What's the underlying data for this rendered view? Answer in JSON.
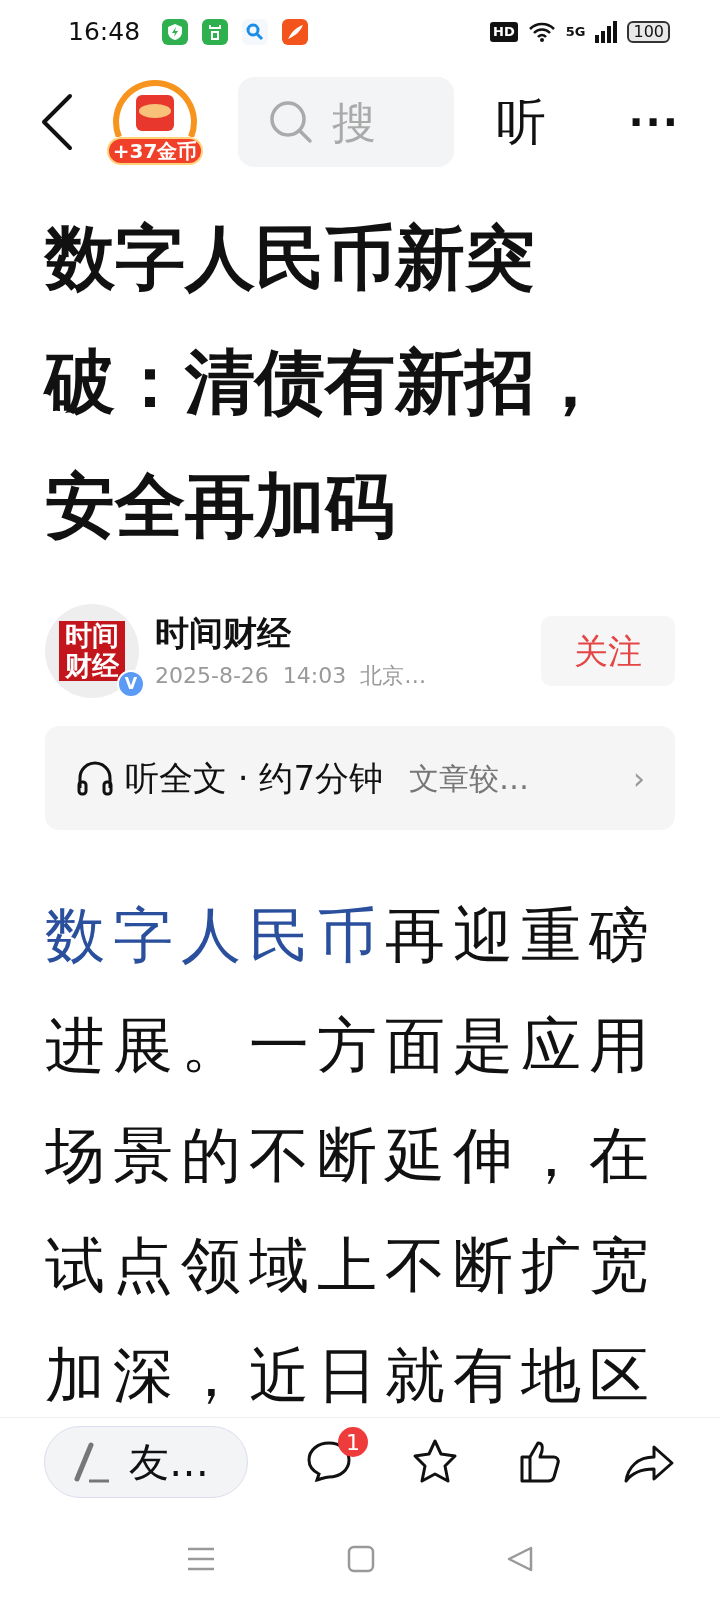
{
  "status_bar": {
    "time": "16:48",
    "hd": "HD",
    "network": "5G",
    "battery": "100"
  },
  "header": {
    "coin_badge": "+37金币",
    "search": {
      "placeholder": "搜"
    },
    "listen": "听",
    "more": "···"
  },
  "article": {
    "title": "数字人民币新突破：清债有新招，安全再加码",
    "author": {
      "name": "时间财经",
      "avatar_text": "时间财经",
      "verified": true,
      "verified_mark": "V",
      "meta": "2025-8-26  14:03  北京…",
      "follow": "关注"
    },
    "audio": {
      "label": "听全文 · 约7分钟",
      "summary": "文章较…",
      "chevron": "›"
    },
    "body": {
      "link": "数字人民币",
      "text": "再迎重磅进展。一方面是应用场景的不断延伸，在试点领域上不断扩宽加深，近日就有地区"
    }
  },
  "bottom_bar": {
    "comment_placeholder": "友…",
    "comment_count": "1"
  }
}
